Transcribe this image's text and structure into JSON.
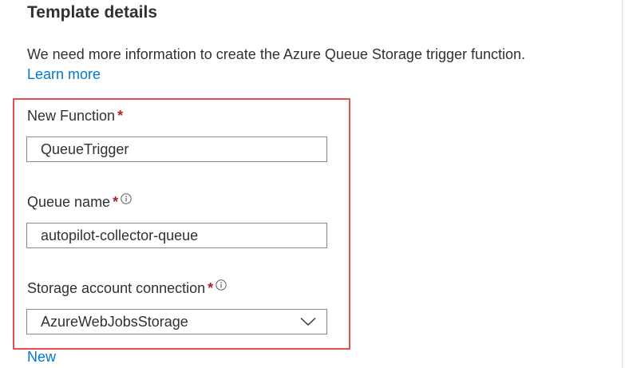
{
  "header": {
    "title": "Template details",
    "description": "We need more information to create the Azure Queue Storage trigger function.",
    "learn_more": "Learn more"
  },
  "form": {
    "required_marker": "*",
    "new_function": {
      "label": "New Function",
      "value": "QueueTrigger"
    },
    "queue_name": {
      "label": "Queue name",
      "value": "autopilot-collector-queue"
    },
    "storage_connection": {
      "label": "Storage account connection",
      "selected": "AzureWebJobsStorage"
    },
    "new_link": "New"
  },
  "icons": {
    "info": "info-icon",
    "dropdown": "chevron-down-icon"
  },
  "colors": {
    "link": "#0078d4",
    "required": "#a4262c",
    "highlight": "#e05252",
    "input_border": "#8a8886"
  }
}
